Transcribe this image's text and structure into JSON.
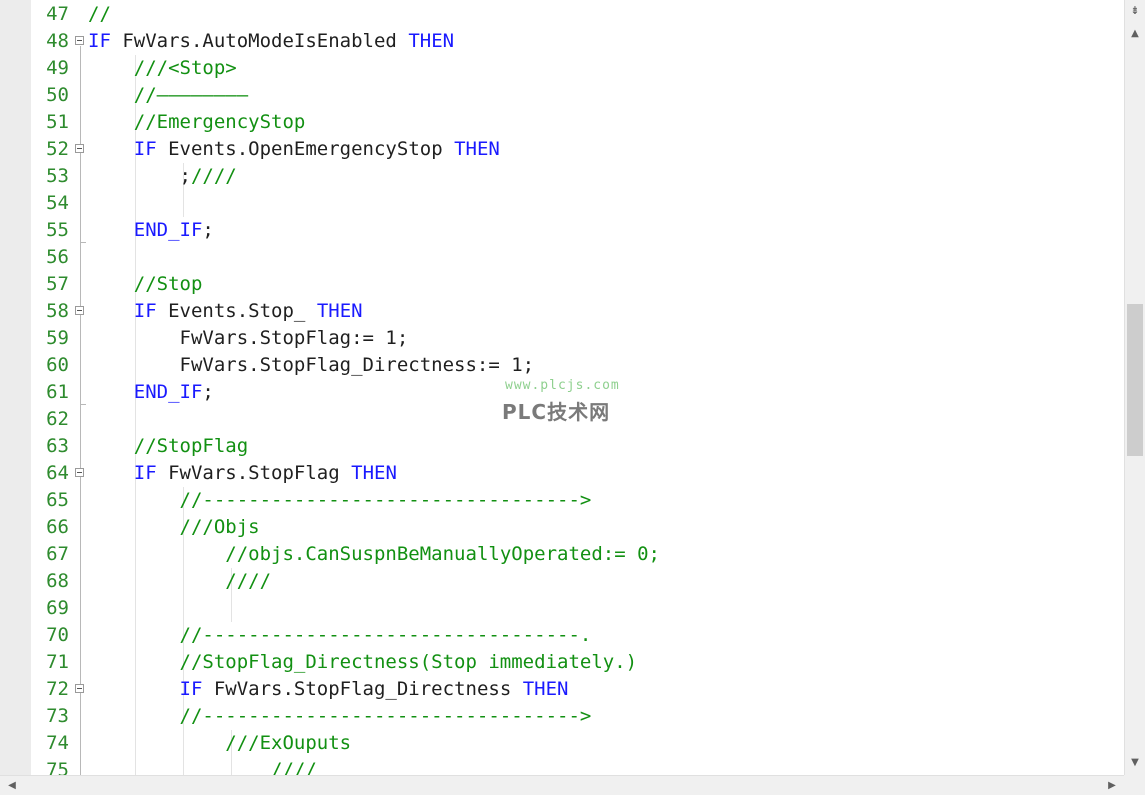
{
  "editor": {
    "lines": [
      {
        "n": "47",
        "segs": [
          {
            "t": "//",
            "c": "cm"
          }
        ]
      },
      {
        "n": "48",
        "fold": true,
        "segs": [
          {
            "t": "IF",
            "c": "kw"
          },
          {
            "t": " FwVars.AutoModeIsEnabled "
          },
          {
            "t": "THEN",
            "c": "kw"
          }
        ]
      },
      {
        "n": "49",
        "segs": [
          {
            "t": "    "
          },
          {
            "t": "///<Stop>",
            "c": "cm"
          }
        ]
      },
      {
        "n": "50",
        "segs": [
          {
            "t": "    "
          },
          {
            "t": "//————————",
            "c": "cm"
          }
        ]
      },
      {
        "n": "51",
        "segs": [
          {
            "t": "    "
          },
          {
            "t": "//EmergencyStop",
            "c": "cm"
          }
        ]
      },
      {
        "n": "52",
        "fold": true,
        "segs": [
          {
            "t": "    "
          },
          {
            "t": "IF",
            "c": "kw"
          },
          {
            "t": " Events.OpenEmergencyStop "
          },
          {
            "t": "THEN",
            "c": "kw"
          }
        ]
      },
      {
        "n": "53",
        "segs": [
          {
            "t": "        ;"
          },
          {
            "t": "////",
            "c": "cm"
          }
        ]
      },
      {
        "n": "54",
        "segs": []
      },
      {
        "n": "55",
        "segs": [
          {
            "t": "    "
          },
          {
            "t": "END_IF",
            "c": "kw"
          },
          {
            "t": ";"
          }
        ]
      },
      {
        "n": "56",
        "segs": []
      },
      {
        "n": "57",
        "segs": [
          {
            "t": "    "
          },
          {
            "t": "//Stop",
            "c": "cm"
          }
        ]
      },
      {
        "n": "58",
        "fold": true,
        "segs": [
          {
            "t": "    "
          },
          {
            "t": "IF",
            "c": "kw"
          },
          {
            "t": " Events.Stop_ "
          },
          {
            "t": "THEN",
            "c": "kw"
          }
        ]
      },
      {
        "n": "59",
        "segs": [
          {
            "t": "        FwVars.StopFlag:= 1;"
          }
        ]
      },
      {
        "n": "60",
        "segs": [
          {
            "t": "        FwVars.StopFlag_Directness:= 1;"
          }
        ]
      },
      {
        "n": "61",
        "segs": [
          {
            "t": "    "
          },
          {
            "t": "END_IF",
            "c": "kw"
          },
          {
            "t": ";"
          }
        ]
      },
      {
        "n": "62",
        "segs": []
      },
      {
        "n": "63",
        "segs": [
          {
            "t": "    "
          },
          {
            "t": "//StopFlag",
            "c": "cm"
          }
        ]
      },
      {
        "n": "64",
        "fold": true,
        "segs": [
          {
            "t": "    "
          },
          {
            "t": "IF",
            "c": "kw"
          },
          {
            "t": " FwVars.StopFlag "
          },
          {
            "t": "THEN",
            "c": "kw"
          }
        ]
      },
      {
        "n": "65",
        "segs": [
          {
            "t": "        "
          },
          {
            "t": "//--------------------------------->",
            "c": "cm"
          }
        ]
      },
      {
        "n": "66",
        "segs": [
          {
            "t": "        "
          },
          {
            "t": "///Objs",
            "c": "cm"
          }
        ]
      },
      {
        "n": "67",
        "segs": [
          {
            "t": "            "
          },
          {
            "t": "//objs.CanSuspnBeManuallyOperated:= 0;",
            "c": "cm"
          }
        ]
      },
      {
        "n": "68",
        "segs": [
          {
            "t": "            "
          },
          {
            "t": "////",
            "c": "cm"
          }
        ]
      },
      {
        "n": "69",
        "segs": []
      },
      {
        "n": "70",
        "segs": [
          {
            "t": "        "
          },
          {
            "t": "//---------------------------------.",
            "c": "cm"
          }
        ]
      },
      {
        "n": "71",
        "segs": [
          {
            "t": "        "
          },
          {
            "t": "//StopFlag_Directness(Stop immediately.)",
            "c": "cm"
          }
        ]
      },
      {
        "n": "72",
        "fold": true,
        "segs": [
          {
            "t": "        "
          },
          {
            "t": "IF",
            "c": "kw"
          },
          {
            "t": " FwVars.StopFlag_Directness "
          },
          {
            "t": "THEN",
            "c": "kw"
          }
        ]
      },
      {
        "n": "73",
        "segs": [
          {
            "t": "        "
          },
          {
            "t": "//--------------------------------->",
            "c": "cm"
          }
        ]
      },
      {
        "n": "74",
        "segs": [
          {
            "t": "            "
          },
          {
            "t": "///ExOuputs",
            "c": "cm"
          }
        ]
      },
      {
        "n": "75",
        "segs": [
          {
            "t": "                "
          },
          {
            "t": "////",
            "c": "cm"
          }
        ]
      }
    ]
  },
  "watermark": {
    "url": "www.plcjs.com",
    "name": "PLC技术网"
  },
  "scrollbar": {
    "split_icon": "split-handle-icon",
    "up_icon": "arrow-up-icon",
    "down_icon": "arrow-down-icon",
    "left_icon": "arrow-left-icon",
    "right_icon": "arrow-right-icon",
    "split_glyph": "⇟",
    "up_glyph": "▲",
    "down_glyph": "▼",
    "left_glyph": "◀",
    "right_glyph": "▶"
  },
  "colors": {
    "keyword": "#1a1aff",
    "comment": "#129012",
    "line_number": "#2e8b2e",
    "text": "#1f1f1f"
  }
}
